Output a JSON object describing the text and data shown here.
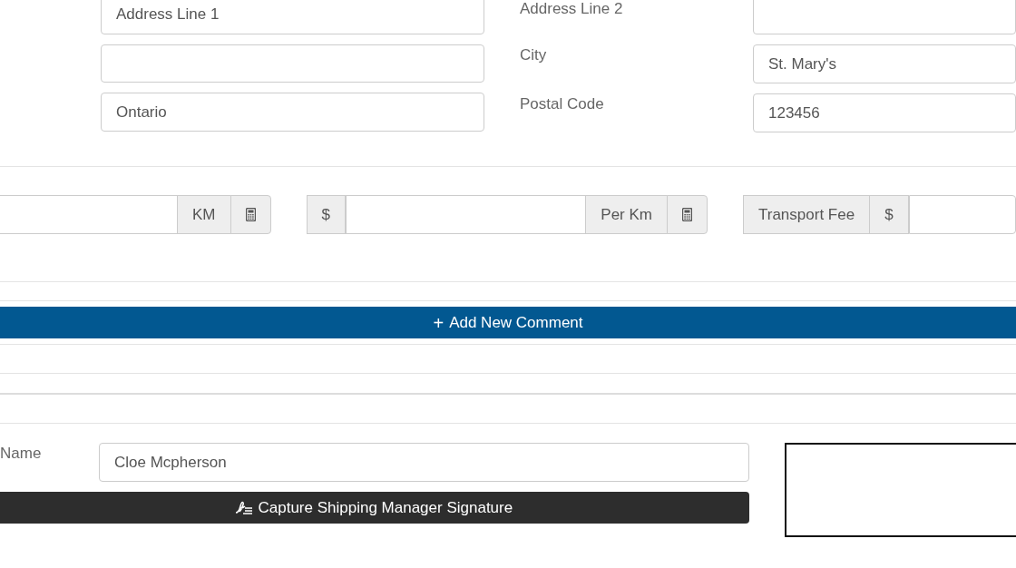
{
  "address": {
    "left_fields": [
      {
        "kind": "text",
        "value": "Address Line 1"
      },
      {
        "kind": "text"
      },
      {
        "kind": "text",
        "value": "Ontario"
      }
    ],
    "right_fields": [
      {
        "kind": "text",
        "label": "Address Line 2"
      },
      {
        "kind": "text",
        "label": "City",
        "value": "St. Mary's"
      },
      {
        "kind": "text",
        "label": "Postal Code",
        "value": "123456"
      }
    ]
  },
  "rates": [
    {
      "items": [
        {
          "kind": "input"
        },
        {
          "kind": "addon",
          "text": "KM"
        },
        {
          "kind": "calc"
        }
      ]
    },
    {
      "items": [
        {
          "kind": "addon",
          "text": "$"
        },
        {
          "kind": "input"
        },
        {
          "kind": "addon",
          "text": "Per Km"
        },
        {
          "kind": "calc"
        }
      ]
    },
    {
      "items": [
        {
          "kind": "addon",
          "text": "Transport Fee"
        },
        {
          "kind": "addon",
          "text": "$"
        },
        {
          "kind": "input"
        }
      ]
    }
  ],
  "comment_button": {
    "icon": "+",
    "label": "Add New Comment"
  },
  "signature": {
    "name_label": "Name",
    "name_value": "Cloe Mcpherson",
    "capture_button": "Capture Shipping Manager Signature"
  }
}
